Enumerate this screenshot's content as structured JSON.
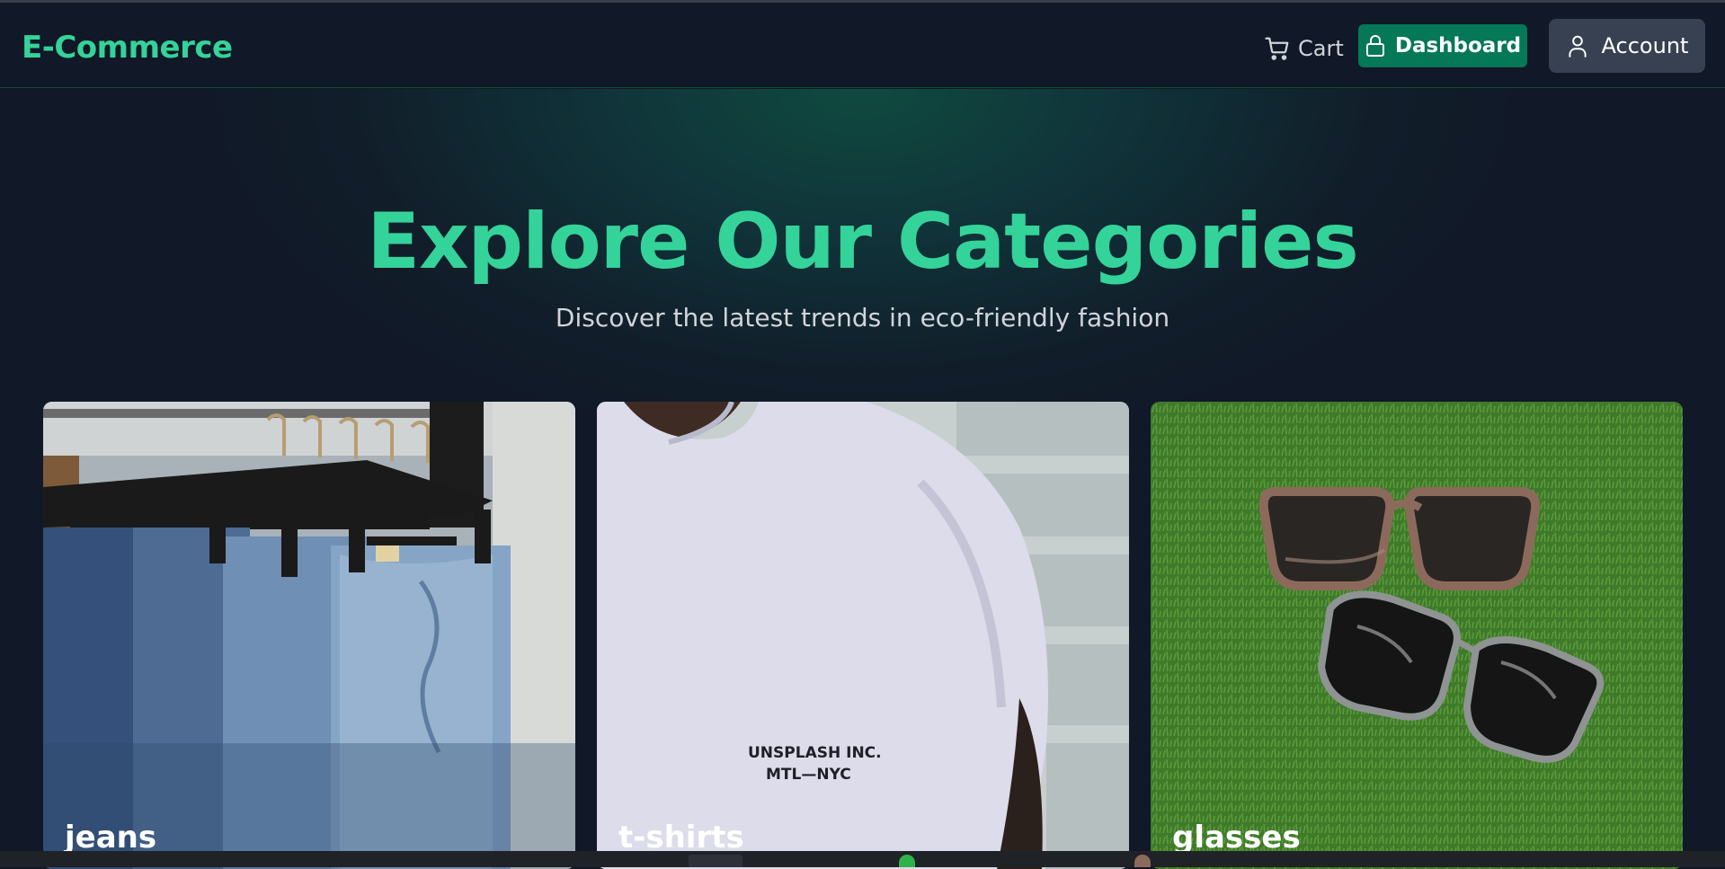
{
  "navbar": {
    "logo": "E-Commerce",
    "cart_label": "Cart",
    "dashboard_label": "Dashboard",
    "account_label": "Account"
  },
  "hero": {
    "title": "Explore Our Categories",
    "subtitle": "Discover the latest trends in eco-friendly fashion"
  },
  "categories": [
    {
      "label": "jeans",
      "image": "jeans-on-hangers"
    },
    {
      "label": "t-shirts",
      "image": "white-tshirt",
      "print_line1": "UNSPLASH INC.",
      "print_line2": "MTL—NYC"
    },
    {
      "label": "glasses",
      "image": "sunglasses-on-grass"
    }
  ],
  "colors": {
    "accent": "#34d399",
    "dashboard_bg": "#047857",
    "account_bg": "#374151",
    "page_bg": "#111827"
  }
}
